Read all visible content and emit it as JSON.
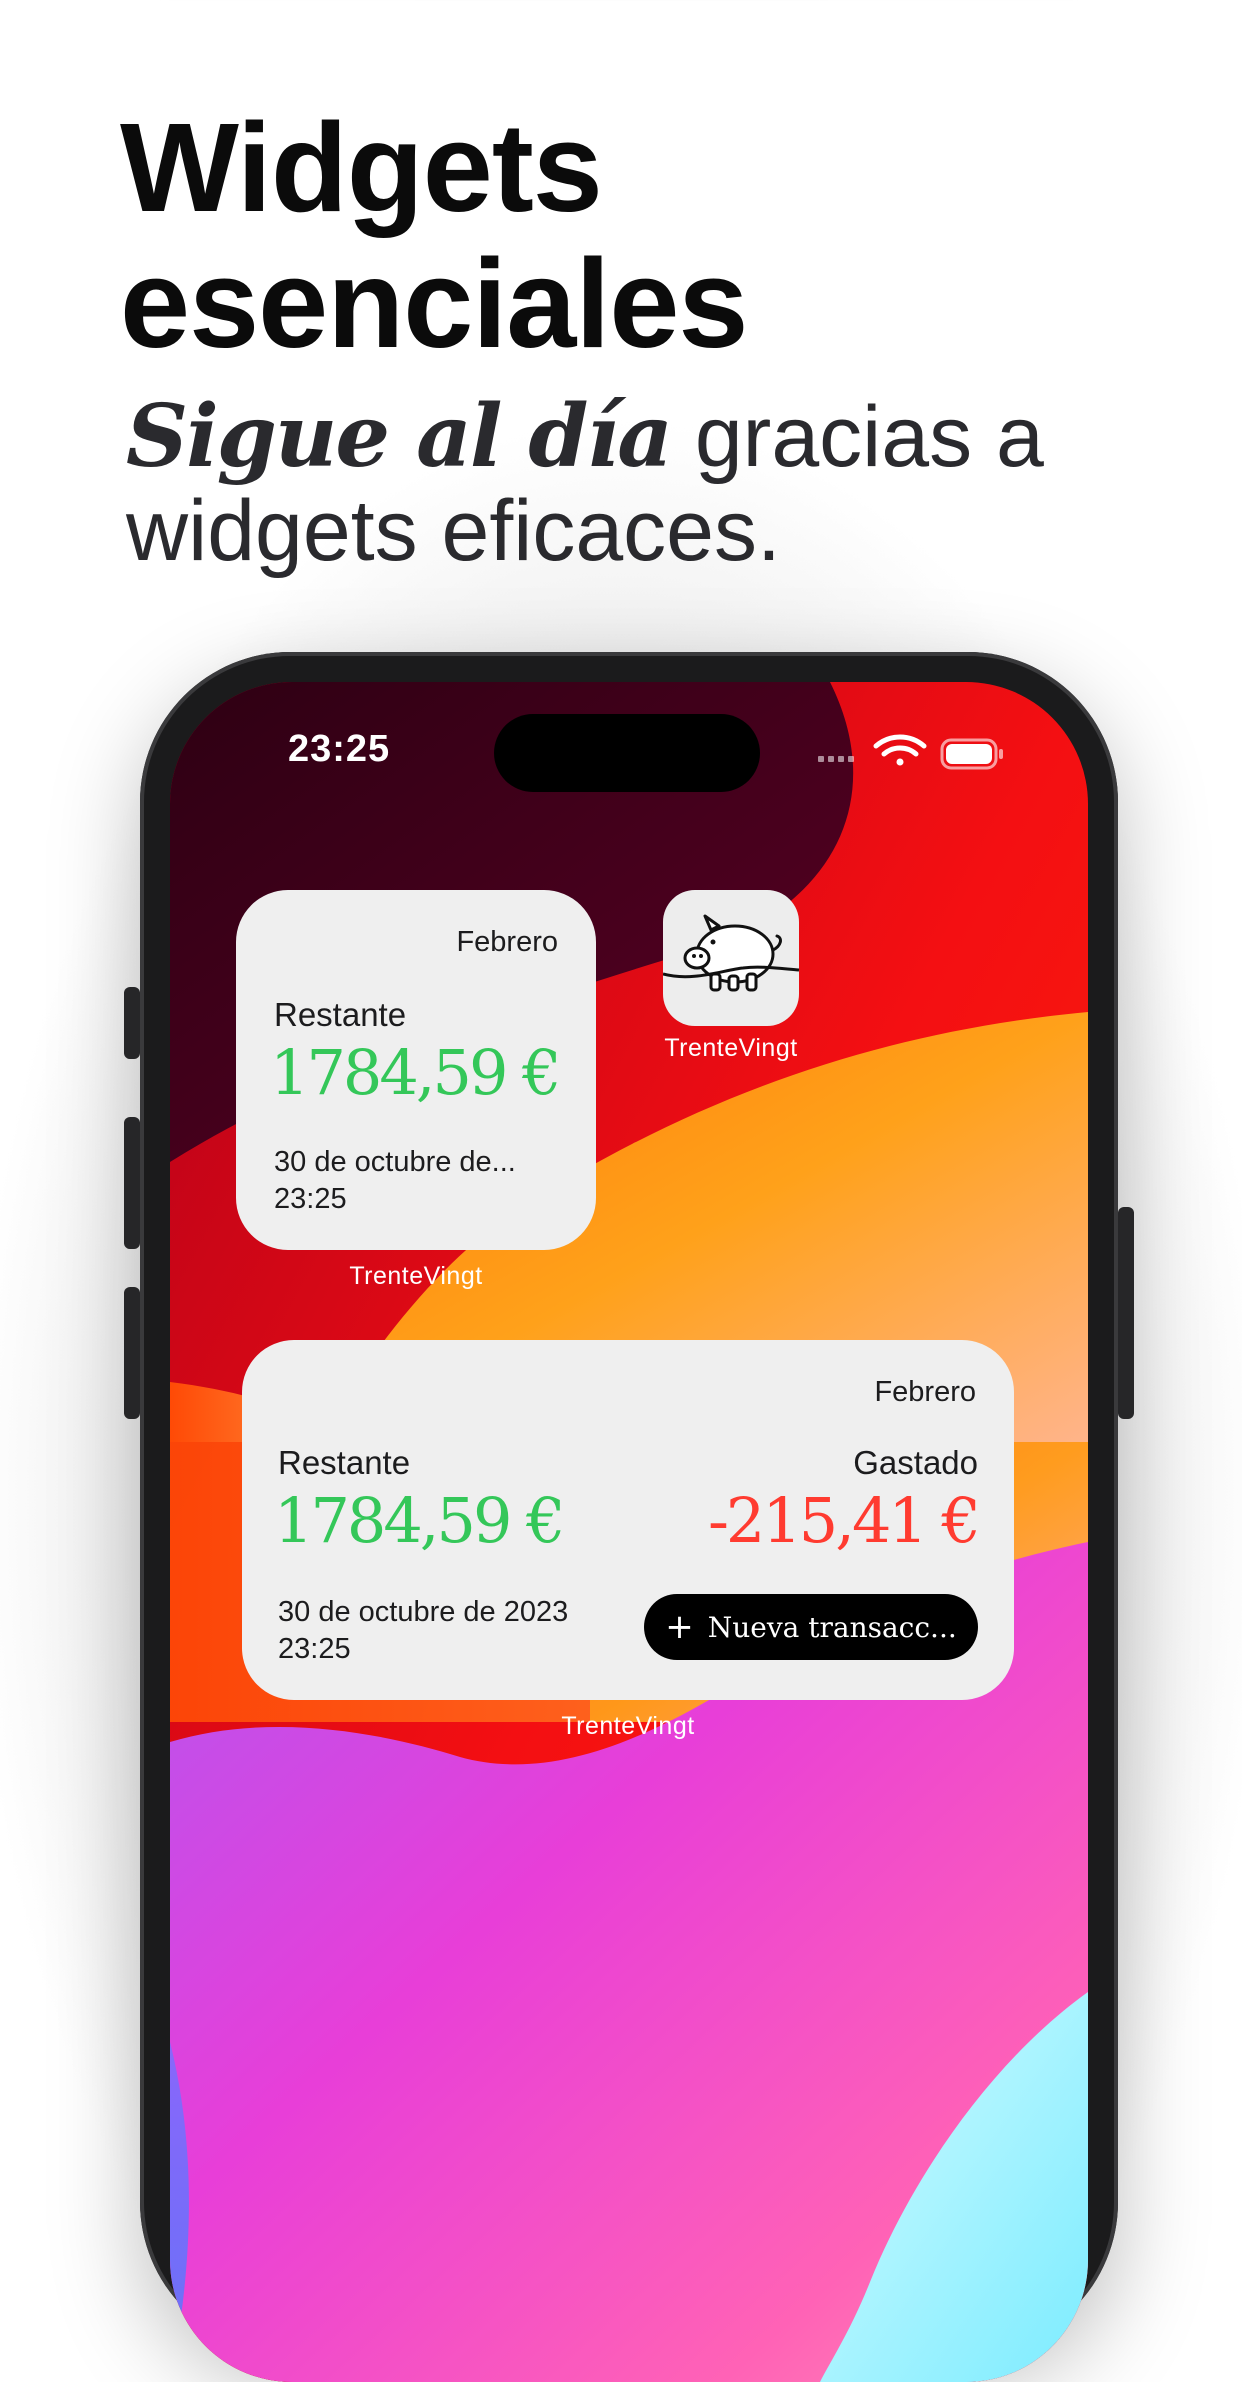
{
  "header": {
    "title_line1": "Widgets",
    "title_line2": "esenciales",
    "subtitle_emphasis": "Sigue al día",
    "subtitle_rest": " gracias a widgets eficaces."
  },
  "status_bar": {
    "time": "23:25",
    "icons": [
      "signal-icon",
      "wifi-icon",
      "battery-icon"
    ]
  },
  "small_widget": {
    "month": "Febrero",
    "remaining_label": "Restante",
    "remaining_amount": "1784,59 €",
    "date": "30 de octubre de...",
    "time": "23:25",
    "caption": "TrenteVingt"
  },
  "app_icon": {
    "label": "TrenteVingt",
    "icon": "piggy-bank-icon"
  },
  "medium_widget": {
    "month": "Febrero",
    "remaining_label": "Restante",
    "remaining_amount": "1784,59 €",
    "spent_label": "Gastado",
    "spent_amount": "-215,41 €",
    "date": "30 de octubre de 2023",
    "time": "23:25",
    "new_transaction_label": "Nueva transacc...",
    "caption": "TrenteVingt"
  },
  "colors": {
    "positive": "#34c759",
    "negative": "#ff3b30",
    "widget_bg": "#efefef"
  }
}
